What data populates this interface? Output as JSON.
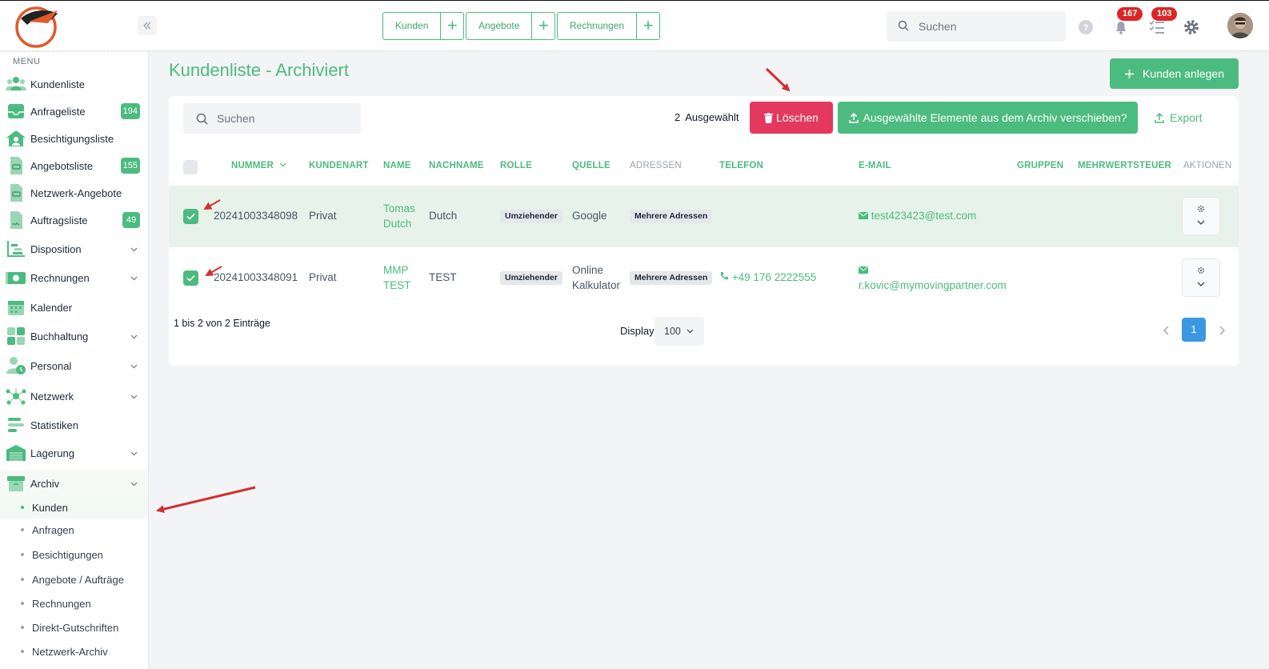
{
  "topbar": {
    "collapse_icon": "chevrons-left-icon",
    "quick_links": [
      {
        "label": "Kunden",
        "add_icon": "plus-icon"
      },
      {
        "label": "Angebote",
        "add_icon": "plus-icon"
      },
      {
        "label": "Rechnungen",
        "add_icon": "plus-icon"
      }
    ],
    "search_placeholder": "Suchen",
    "notifications_count": "167",
    "tasks_count": "103"
  },
  "sidebar": {
    "menu_label": "MENU",
    "items": [
      {
        "label": "Kundenliste",
        "icon": "customers-icon"
      },
      {
        "label": "Anfrageliste",
        "icon": "inbox-icon",
        "badge": "194"
      },
      {
        "label": "Besichtigungsliste",
        "icon": "house-icon"
      },
      {
        "label": "Angebotsliste",
        "icon": "document-icon",
        "badge": "155"
      },
      {
        "label": "Netzwerk-Angebote",
        "icon": "document-icon"
      },
      {
        "label": "Auftragsliste",
        "icon": "document-signed-icon",
        "badge": "49"
      },
      {
        "label": "Disposition",
        "icon": "disposition-icon"
      },
      {
        "label": "Rechnungen",
        "icon": "money-icon"
      },
      {
        "label": "Kalender",
        "icon": "calendar-icon"
      },
      {
        "label": "Buchhaltung",
        "icon": "calculator-icon"
      },
      {
        "label": "Personal",
        "icon": "staff-icon"
      },
      {
        "label": "Netzwerk",
        "icon": "network-icon"
      },
      {
        "label": "Statistiken",
        "icon": "stats-icon"
      },
      {
        "label": "Lagerung",
        "icon": "warehouse-icon"
      },
      {
        "label": "Archiv",
        "icon": "archive-icon"
      }
    ],
    "archive_sub": [
      {
        "label": "Kunden"
      },
      {
        "label": "Anfragen"
      },
      {
        "label": "Besichtigungen"
      },
      {
        "label": "Angebote / Aufträge"
      },
      {
        "label": "Rechnungen"
      },
      {
        "label": "Direkt-Gutschriften"
      },
      {
        "label": "Netzwerk-Archiv"
      }
    ]
  },
  "main": {
    "title": "Kundenliste - Archiviert",
    "add_button": "Kunden anlegen",
    "search_placeholder": "Suchen",
    "selected_number": "2",
    "selected_label": "Ausgewählt",
    "delete_button": "Löschen",
    "unarchive_button": "Ausgewählte Elemente aus dem Archiv verschieben?",
    "export_button": "Export",
    "columns": [
      "NUMMER",
      "KUNDENART",
      "NAME",
      "NACHNAME",
      "ROLLE",
      "QUELLE",
      "ADRESSEN",
      "TELEFON",
      "E-MAIL",
      "GRUPPEN",
      "MEHRWERTSTEUER",
      "AKTIONEN"
    ],
    "rows": [
      {
        "checked": true,
        "number": "20241003348098",
        "type": "Privat",
        "name": "Tomas Dutch",
        "lastname": "Dutch",
        "role": "Umziehender",
        "source": "Google",
        "addresses": "Mehrere Adressen",
        "phone": "",
        "email": "test423423@test.com"
      },
      {
        "checked": true,
        "number": "20241003348091",
        "type": "Privat",
        "name": "MMP TEST",
        "lastname": "TEST",
        "role": "Umziehender",
        "source": "Online Kalkulator",
        "addresses": "Mehrere Adressen",
        "phone": "+49 176 2222555",
        "email": "r.kovic@mymovingpartner.com"
      }
    ],
    "info": "1 bis 2 von 2 Einträge",
    "display_label": "Display",
    "display_value": "100",
    "current_page": "1"
  },
  "colors": {
    "accent": "#4cbb7f",
    "danger": "#e4385e",
    "badge": "#dc2626",
    "page": "#3b97e3",
    "annotation": "#d32f2f"
  }
}
